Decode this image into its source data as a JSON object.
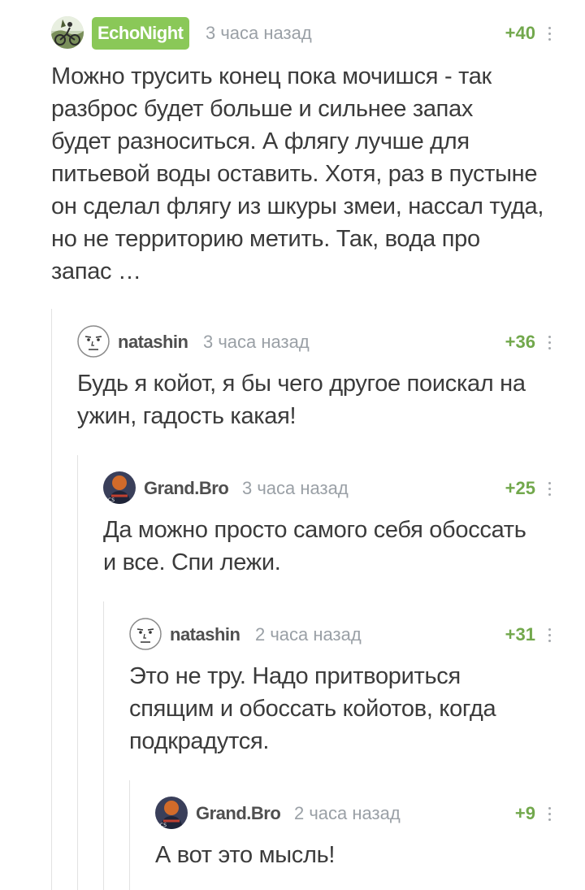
{
  "comments": [
    {
      "author": "EchoNight",
      "time": "3 часа назад",
      "rating": "+40",
      "lines": [
        "Можно трусить конец пока мочишся - так",
        "разброс будет больше и сильнее запах",
        "будет разноситься. А флягу лучше для",
        "питьевой воды оставить. Хотя, раз в пустыне",
        "он сделал флягу из шкуры змеи, нассал туда,",
        "но не территорию метить. Так, вода про",
        "запас …"
      ]
    },
    {
      "author": "natashin",
      "time": "3 часа назад",
      "rating": "+36",
      "lines": [
        "Будь я койот, я бы чего другое поискал на",
        "ужин, гадость какая!"
      ]
    },
    {
      "author": "Grand.Bro",
      "time": "3 часа назад",
      "rating": "+25",
      "lines": [
        "Да можно просто самого себя обоссать",
        "и все. Спи лежи."
      ]
    },
    {
      "author": "natashin",
      "time": "2 часа назад",
      "rating": "+31",
      "lines": [
        "Это не тру. Надо притвориться",
        "спящим и обоссать койотов, когда",
        "подкрадутся."
      ]
    },
    {
      "author": "Grand.Bro",
      "time": "2 часа назад",
      "rating": "+9",
      "lines": [
        "А вот это мысль!"
      ]
    }
  ],
  "colors": {
    "badge": "#8ac858",
    "rating": "#72a84c",
    "meta": "#9aa0a6",
    "text": "#3b3b3b"
  },
  "icons": {
    "echonight_avatar": "cyclist-avatar-icon",
    "natashin_avatar": "meme-face-avatar-icon",
    "grandbro_avatar": "grand-bro-avatar-icon",
    "menu": "kebab-menu-icon"
  }
}
